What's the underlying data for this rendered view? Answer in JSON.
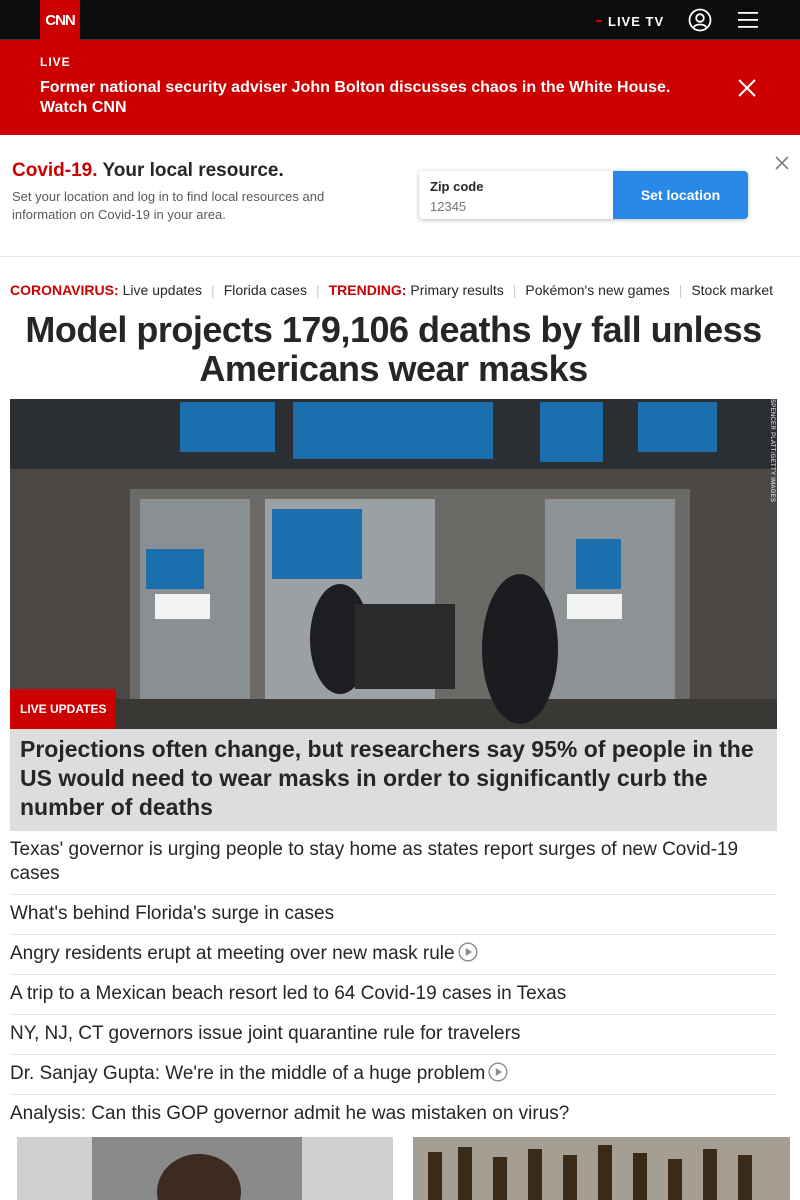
{
  "header": {
    "logo_text": "CNN",
    "live_tv_label": "LIVE TV",
    "icons": [
      "account-icon",
      "menu-icon"
    ]
  },
  "live_banner": {
    "label": "LIVE",
    "headline": "Former national security adviser John Bolton discusses chaos in the White House. Watch CNN",
    "background": "#cc0000"
  },
  "covid_resource": {
    "title_red": "Covid-19.",
    "title_rest": "Your local resource.",
    "description": "Set your location and log in to find local resources and information on Covid-19 in your area.",
    "zip_label": "Zip code",
    "zip_placeholder": "12345",
    "button_label": "Set location",
    "button_color": "#2a88e8"
  },
  "trending_bar": {
    "coronavirus_tag": "CORONAVIRUS:",
    "coronavirus_links": [
      "Live updates",
      "Florida cases"
    ],
    "trending_tag": "TRENDING:",
    "trending_links": [
      "Primary results",
      "Pokémon's new games",
      "Stock market"
    ]
  },
  "main": {
    "headline": "Model projects 179,106 deaths by fall unless Americans wear masks",
    "hero": {
      "credit": "SPENCER PLATT/GETTY IMAGES",
      "badge": "LIVE UPDATES",
      "caption": "Projections often change, but researchers say 95% of people in the US would need to wear masks in order to significantly curb the number of deaths"
    },
    "stories": [
      {
        "text": "Texas' governor is urging people to stay home as states report surges of new Covid-19 cases",
        "video": false
      },
      {
        "text": "What's behind Florida's surge in cases",
        "video": false
      },
      {
        "text": "Angry residents erupt at meeting over new mask rule",
        "video": true
      },
      {
        "text": "A trip to a Mexican beach resort led to 64 Covid-19 cases in Texas",
        "video": false
      },
      {
        "text": "NY, NJ, CT governors issue joint quarantine rule for travelers",
        "video": false
      },
      {
        "text": "Dr. Sanjay Gupta: We're in the middle of a huge problem",
        "video": true
      },
      {
        "text": "Analysis: Can this GOP governor admit he was mistaken on virus?",
        "video": false
      }
    ]
  }
}
